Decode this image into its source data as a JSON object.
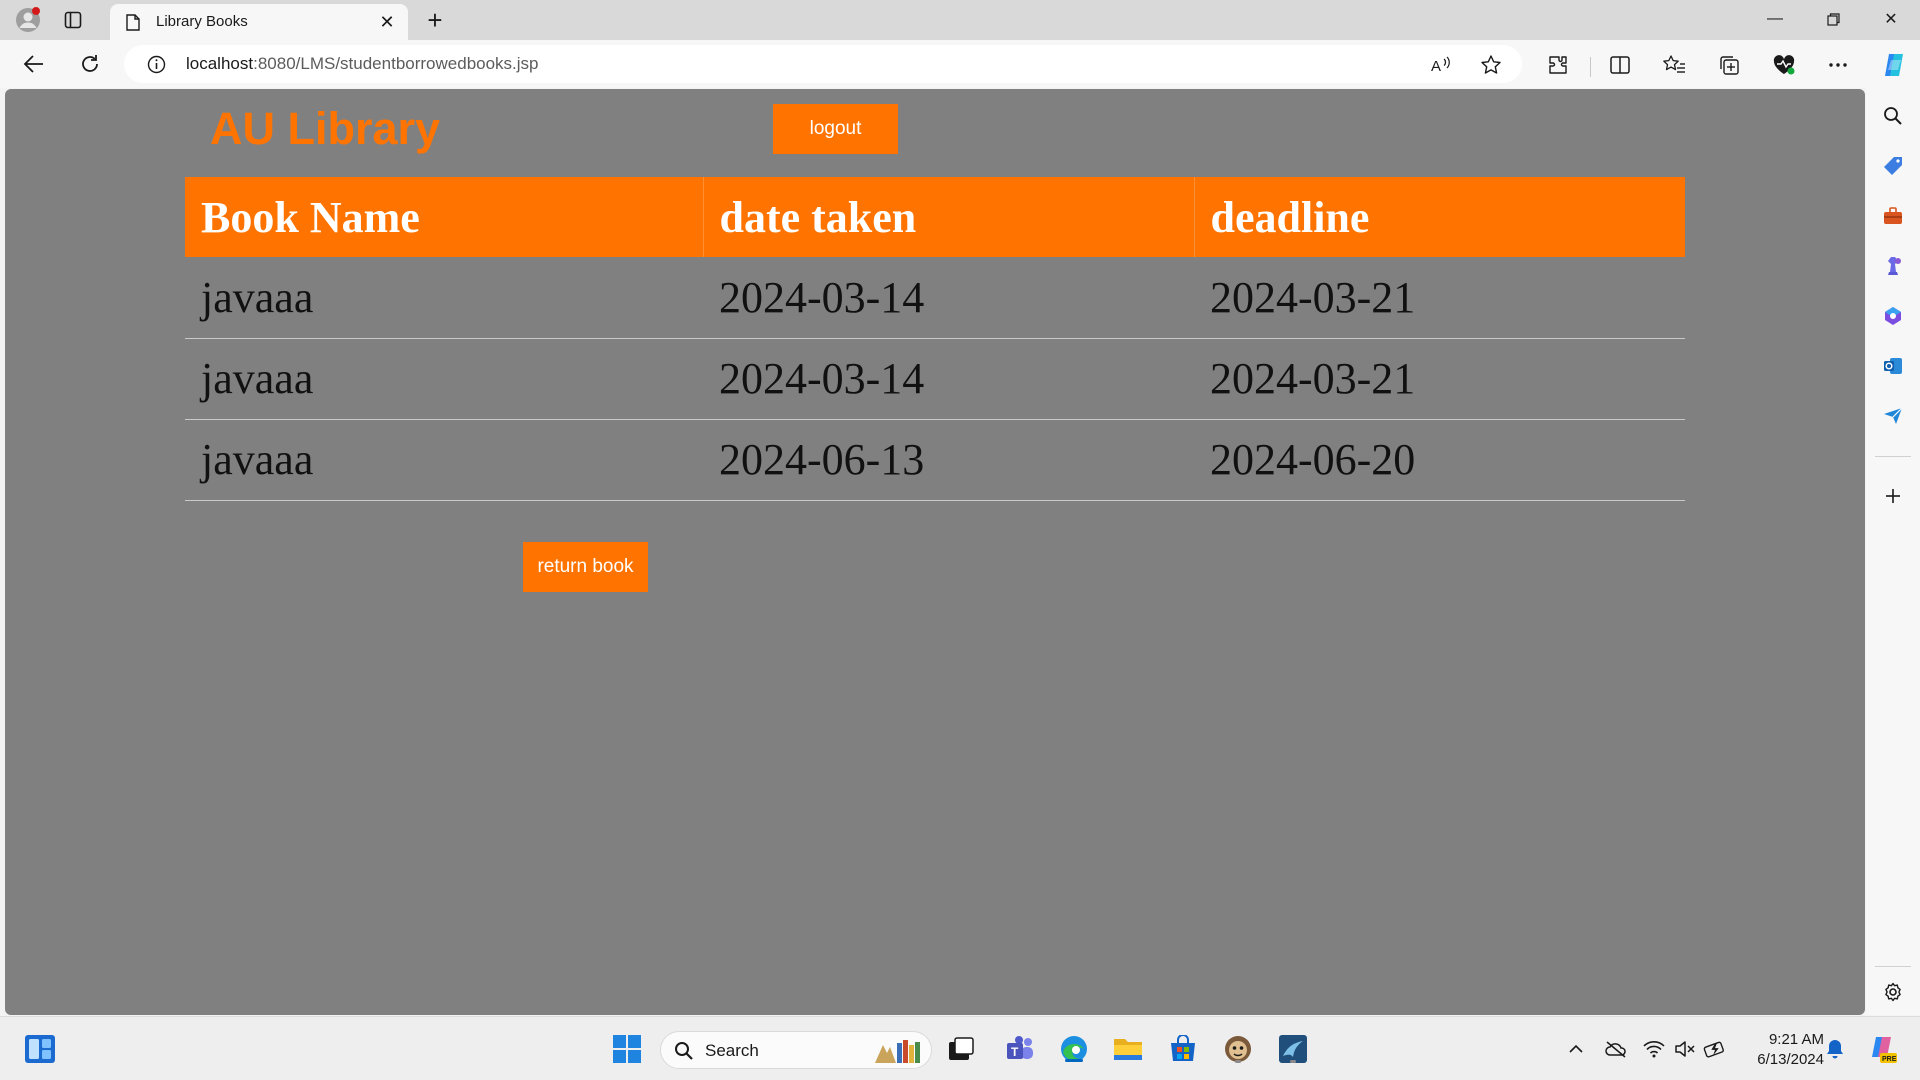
{
  "browser": {
    "tab_title": "Library Books",
    "url_host": "localhost",
    "url_rest": ":8080/LMS/studentborrowedbooks.jsp"
  },
  "page": {
    "site_title": "AU Library",
    "logout_label": "logout",
    "return_label": "return book",
    "table": {
      "headers": [
        "Book Name",
        "date taken",
        "deadline"
      ],
      "rows": [
        [
          "javaaa",
          "2024-03-14",
          "2024-03-21"
        ],
        [
          "javaaa",
          "2024-03-14",
          "2024-03-21"
        ],
        [
          "javaaa",
          "2024-06-13",
          "2024-06-20"
        ]
      ]
    },
    "colors": {
      "accent": "#ff7400",
      "background": "#808080"
    }
  },
  "taskbar": {
    "search_label": "Search",
    "time": "9:21 AM",
    "date": "6/13/2024"
  }
}
